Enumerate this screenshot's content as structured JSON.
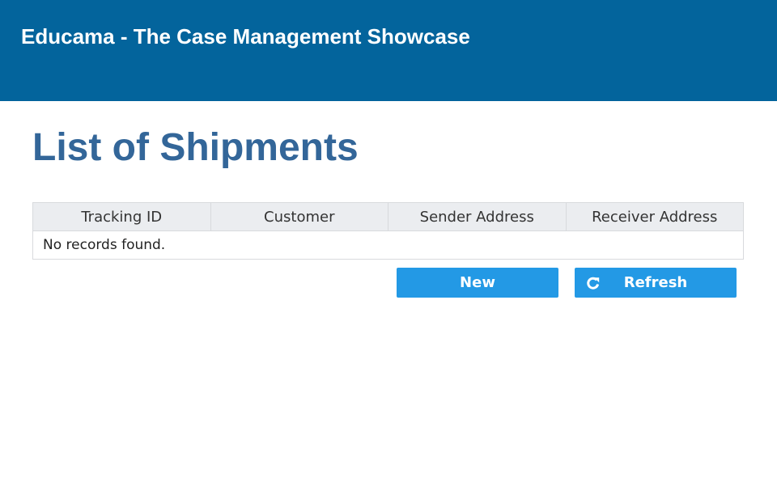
{
  "header": {
    "title": "Educama - The Case Management Showcase"
  },
  "page": {
    "title": "List of Shipments"
  },
  "table": {
    "columns": [
      "Tracking ID",
      "Customer",
      "Sender Address",
      "Receiver Address"
    ],
    "empty_message": "No records found."
  },
  "actions": {
    "new_label": "New",
    "refresh_label": "Refresh",
    "refresh_icon": "refresh-icon"
  },
  "colors": {
    "header_bg": "#03649c",
    "title_text": "#336699",
    "button_bg": "#2399e5",
    "table_header_bg": "#ebedf0"
  }
}
